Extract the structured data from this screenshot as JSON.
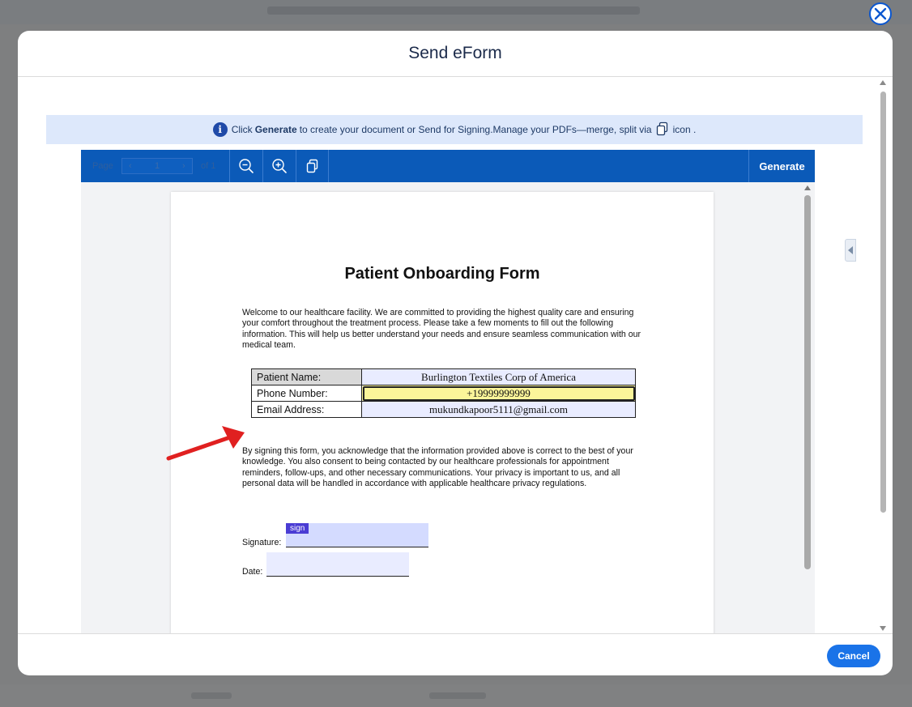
{
  "modal": {
    "title": "Send eForm",
    "info": {
      "pre": "Click",
      "bold": "Generate",
      "mid": "to create your document or Send for Signing.Manage your PDFs—merge, split via",
      "post": "icon ."
    },
    "toolbar": {
      "page_label": "Page",
      "page_value": "1",
      "of_label": "of 1",
      "generate_label": "Generate",
      "icons": [
        "zoom-out-icon",
        "zoom-in-icon",
        "copy-pages-icon"
      ]
    },
    "cancel_label": "Cancel"
  },
  "document": {
    "title": "Patient Onboarding Form",
    "intro": "Welcome to our healthcare facility. We are committed to providing the highest quality care and ensuring your comfort throughout the treatment process. Please take a few moments to fill out the following information. This will help us better understand your needs and ensure seamless communication with our medical team.",
    "fields": [
      {
        "label": "Patient Name:",
        "value": "Burlington Textiles Corp of America"
      },
      {
        "label": "Phone Number:",
        "value": "+19999999999"
      },
      {
        "label": "Email Address:",
        "value": "mukundkapoor5111@gmail.com"
      }
    ],
    "consent": "By signing this form, you acknowledge that the information provided above is correct to the best of your knowledge. You also consent to being contacted by our healthcare professionals for appointment reminders, follow-ups, and other necessary communications. Your privacy is important to us, and all personal data will be handled in accordance with applicable healthcare privacy regulations.",
    "signature_label": "Signature:",
    "signature_tag": "sign",
    "date_label": "Date:"
  },
  "colors": {
    "toolbar": "#0b5ab8",
    "info_bg": "#dde8fb",
    "highlight_field": "#fbf59a",
    "annotation_arrow": "#e02020",
    "cancel_button": "#1a73e8"
  }
}
